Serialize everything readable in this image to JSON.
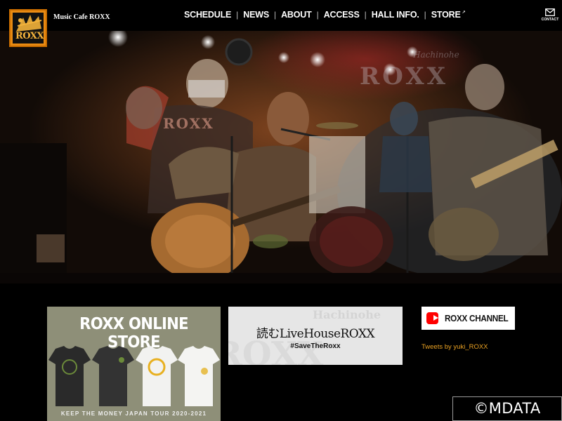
{
  "header": {
    "logo_text": "ROXX",
    "site_name": "Music Cafe ROXX",
    "nav": [
      {
        "label": "SCHEDULE"
      },
      {
        "label": "NEWS"
      },
      {
        "label": "ABOUT"
      },
      {
        "label": "ACCESS"
      },
      {
        "label": "HALL INFO."
      },
      {
        "label": "STORE",
        "external": true
      }
    ],
    "contact_label": "CONTACT",
    "contact_icon": "envelope-icon"
  },
  "hero": {
    "sign_text": "ROXX",
    "sign_small": "Hachinohe",
    "shirt_text": "ROXX"
  },
  "banners": {
    "store": {
      "title": "ROXX ONLINE STORE",
      "subtitle": "KEEP THE MONEY JAPAN TOUR 2020-2021"
    },
    "read": {
      "bg_text": "Hachinohe",
      "bg_text2": "ROXX",
      "title": "読むLiveHouseROXX",
      "subtitle": "#SaveTheRoxx"
    },
    "youtube": {
      "label": "ROXX CHANNEL",
      "icon": "youtube-icon"
    },
    "tweets": "Tweets by yuki_ROXX"
  },
  "watermark": "©MDATA",
  "colors": {
    "logo_orange": "#e88a12",
    "tweets_link": "#e8a022",
    "store_bg": "#8e8f78",
    "youtube_red": "#ff0000"
  }
}
